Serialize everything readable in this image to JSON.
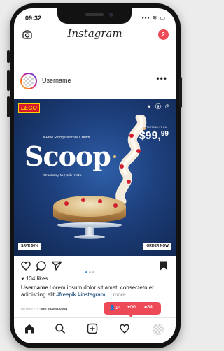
{
  "status": {
    "time": "09:32",
    "icons": "▪▪▪ ≋ ▭"
  },
  "header": {
    "app_title": "Instagram",
    "notification_count": "2"
  },
  "post": {
    "username": "Username",
    "more": "•••",
    "likes": "134 likes",
    "caption_user": "Username",
    "caption_text": " Lorem ipsum dolor sit amet, consectetu er adipiscing elit ",
    "caption_tag1": "#freepik",
    "caption_tag2": "#instagram",
    "caption_ellipsis": " ... ",
    "caption_more": "more",
    "date_label": "DD MM YYYY",
    "see_translation": "SEE TRANSLATION",
    "carousel": {
      "count": 3,
      "active": 0
    }
  },
  "ad": {
    "brand": "LEGO",
    "socials": "♥ ⓢ ℗",
    "price_label": "PRICE STARTING FROM",
    "price_main": "$99,",
    "price_cents": "99",
    "subtitle": "Oil-Free Refrigerator Ice Cream",
    "title": "Scoop",
    "flavors": "Strawberry, Nut, Milk, Cake",
    "save_label": "SAVE 50%",
    "order_label": "ORDER NOW"
  },
  "notifications": {
    "followers": "14",
    "likes": "06",
    "comments": "84"
  },
  "colors": {
    "accent": "#ed4956",
    "link": "#003569",
    "ad_bg": "#1d3f7c"
  }
}
